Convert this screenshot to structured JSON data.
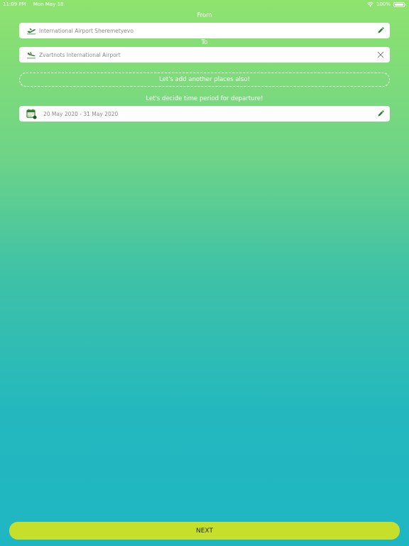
{
  "status_bar": {
    "time": "11:09 PM",
    "date": "Mon May 18",
    "battery": "100%"
  },
  "from": {
    "label": "From",
    "value": "International Airport Sheremetyevo",
    "icon": "plane-takeoff-icon",
    "action_icon": "pencil-icon"
  },
  "to": {
    "label": "To",
    "value": "Zvartnots International Airport",
    "icon": "plane-landing-icon",
    "action_icon": "close-icon"
  },
  "add_places": {
    "label": "Let's add another places also!"
  },
  "departure": {
    "label": "Let's decide time period for departure!",
    "value": "20 May 2020 - 31 May 2020",
    "icon": "calendar-icon",
    "action_icon": "pencil-icon"
  },
  "next_button": {
    "label": "NEXT"
  },
  "colors": {
    "gradient_top": "#8fe36e",
    "gradient_bottom": "#1fb6c3",
    "next_button": "#c6df2a",
    "icon_green": "#2e7d32"
  }
}
